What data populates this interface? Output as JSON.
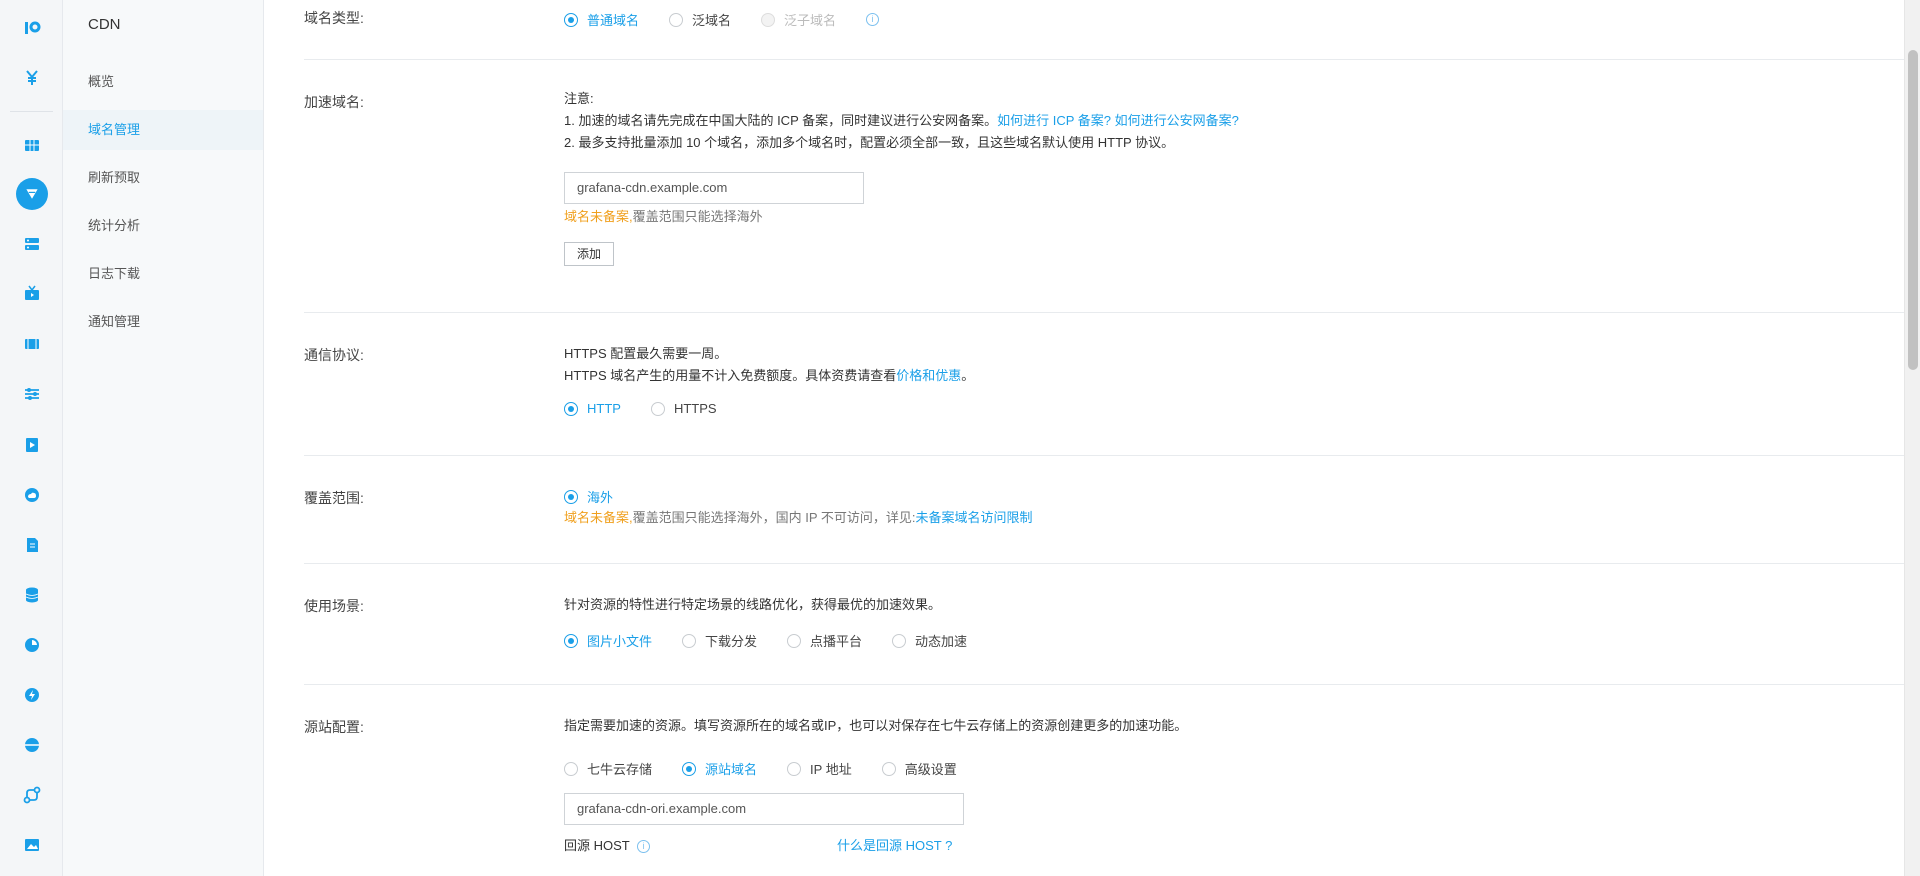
{
  "colors": {
    "accent": "#1a9fe8",
    "warning": "#f0a01e"
  },
  "rail": {
    "items": [
      {
        "icon": "qiniu-logo-icon"
      },
      {
        "icon": "yuan-icon"
      },
      {
        "icon": "grid-icon"
      },
      {
        "icon": "cdn-icon"
      },
      {
        "icon": "server-icon"
      },
      {
        "icon": "live-icon"
      },
      {
        "icon": "film-icon"
      },
      {
        "icon": "sliders-icon"
      },
      {
        "icon": "video-icon"
      },
      {
        "icon": "cloud-icon"
      },
      {
        "icon": "document-icon"
      },
      {
        "icon": "database-icon"
      },
      {
        "icon": "pie-icon"
      },
      {
        "icon": "bolt-icon"
      },
      {
        "icon": "globe-icon"
      },
      {
        "icon": "route-icon"
      },
      {
        "icon": "image-icon"
      }
    ]
  },
  "subnav": {
    "title": "CDN",
    "items": [
      "概览",
      "域名管理",
      "刷新预取",
      "统计分析",
      "日志下载",
      "通知管理"
    ],
    "active": "域名管理"
  },
  "domain_type": {
    "label": "域名类型:",
    "options": [
      "普通域名",
      "泛域名",
      "泛子域名"
    ],
    "selected": "普通域名"
  },
  "accel_domain": {
    "label": "加速域名:",
    "note_title": "注意:",
    "note1": "1. 加速的域名请先完成在中国大陆的 ICP 备案，同时建议进行公安网备案。",
    "note1_link": "如何进行 ICP 备案? 如何进行公安网备案?",
    "note2": "2. 最多支持批量添加 10 个域名，添加多个域名时，配置必须全部一致，且这些域名默认使用 HTTP 协议。",
    "input_value": "grafana-cdn.example.com",
    "warn_text": "域名未备案,",
    "warn_rest": "覆盖范围只能选择海外",
    "add_button": "添加"
  },
  "protocol": {
    "label": "通信协议:",
    "line1": "HTTPS 配置最久需要一周。",
    "line2": "HTTPS 域名产生的用量不计入免费额度。具体资费请查看",
    "line2_link": "价格和优惠",
    "line2_end": "。",
    "options": [
      "HTTP",
      "HTTPS"
    ],
    "selected": "HTTP"
  },
  "coverage": {
    "label": "覆盖范围:",
    "option": "海外",
    "warn_text": "域名未备案,",
    "warn_rest": "覆盖范围只能选择海外，国内 IP 不可访问，详见:",
    "warn_link": "未备案域名访问限制"
  },
  "scene": {
    "label": "使用场景:",
    "desc": "针对资源的特性进行特定场景的线路优化，获得最优的加速效果。",
    "options": [
      "图片小文件",
      "下载分发",
      "点播平台",
      "动态加速"
    ],
    "selected": "图片小文件"
  },
  "origin": {
    "label": "源站配置:",
    "desc": "指定需要加速的资源。填写资源所在的域名或IP，也可以对保存在七牛云存储上的资源创建更多的加速功能。",
    "options": [
      "七牛云存储",
      "源站域名",
      "IP 地址",
      "高级设置"
    ],
    "selected": "源站域名",
    "input_value": "grafana-cdn-ori.example.com",
    "host_label": "回源 HOST",
    "host_link": "什么是回源 HOST ?"
  }
}
